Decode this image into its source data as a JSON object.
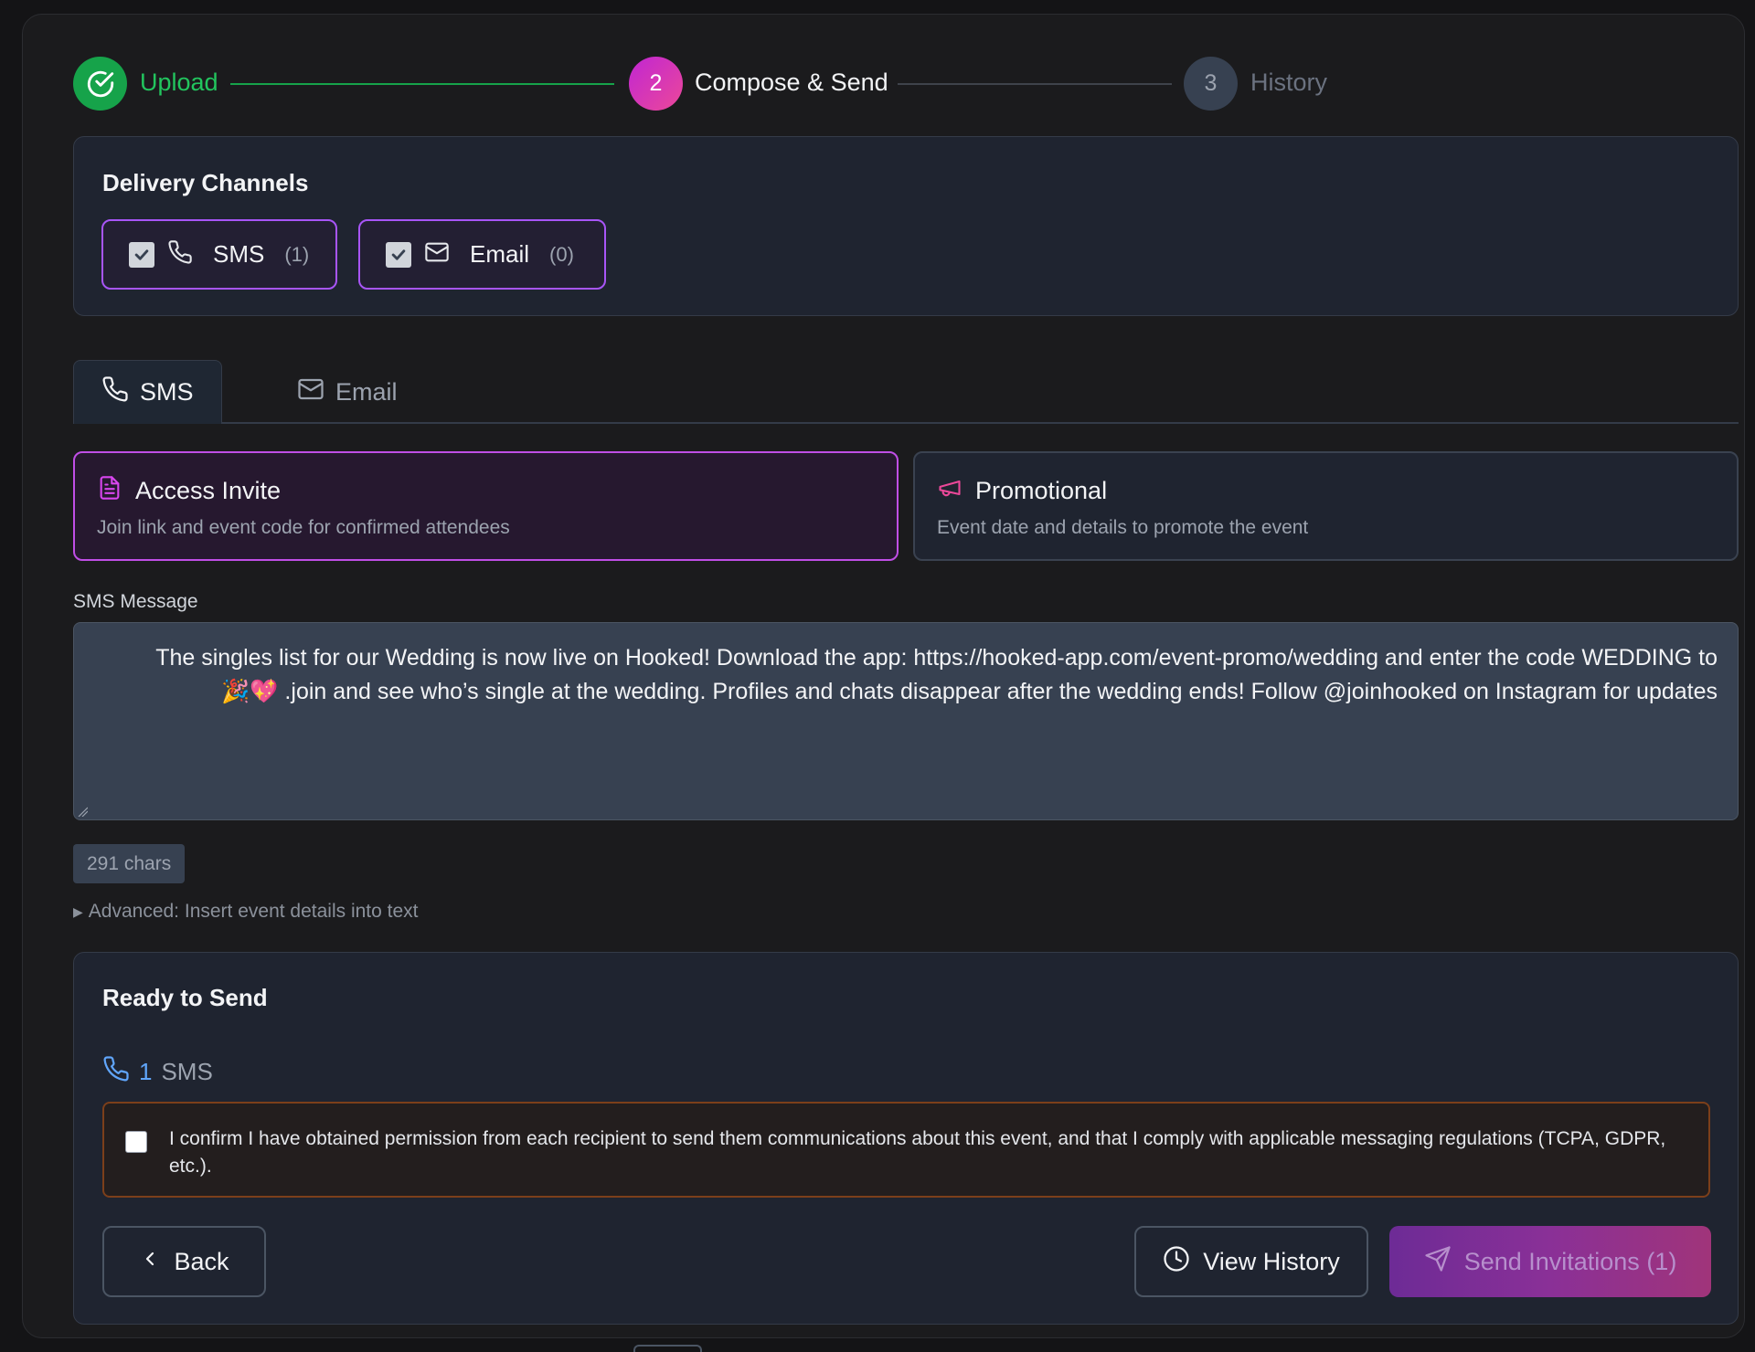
{
  "stepper": {
    "steps": [
      {
        "number": "✓",
        "label": "Upload"
      },
      {
        "number": "2",
        "label": "Compose & Send"
      },
      {
        "number": "3",
        "label": "History"
      }
    ]
  },
  "delivery": {
    "title": "Delivery Channels",
    "channels": [
      {
        "label": "SMS",
        "count": "(1)",
        "icon": "phone-icon",
        "checked": true
      },
      {
        "label": "Email",
        "count": "(0)",
        "icon": "mail-icon",
        "checked": true
      }
    ]
  },
  "tabs": [
    {
      "label": "SMS",
      "icon": "phone-icon",
      "active": true
    },
    {
      "label": "Email",
      "icon": "mail-icon",
      "active": false
    }
  ],
  "templates": [
    {
      "title": "Access Invite",
      "description": "Join link and event code for confirmed attendees",
      "icon": "document-icon",
      "selected": true
    },
    {
      "title": "Promotional",
      "description": "Event date and details to promote the event",
      "icon": "megaphone-icon",
      "selected": false
    }
  ],
  "message": {
    "label": "SMS Message",
    "text": "The singles list for our Wedding is now live on Hooked! Download the app: https://hooked-app.com/event-promo/wedding and enter the code WEDDING to join and see who’s single at the wedding. Profiles and chats disappear after the wedding ends! Follow @joinhooked on Instagram for updates. 💖🎉",
    "char_count": "291 chars",
    "advanced_label": "Advanced: Insert event details into text"
  },
  "ready": {
    "title": "Ready to Send",
    "count": "1",
    "channel": "SMS",
    "confirm_text": "I confirm I have obtained permission from each recipient to send them communications about this event, and that I comply with applicable messaging regulations (TCPA, GDPR, etc.).",
    "back_label": "Back",
    "history_label": "View History",
    "send_label": "Send Invitations (1)"
  },
  "colors": {
    "accent": "#a855f7",
    "success": "#16a34a",
    "warning_border": "#7c3f1a"
  }
}
